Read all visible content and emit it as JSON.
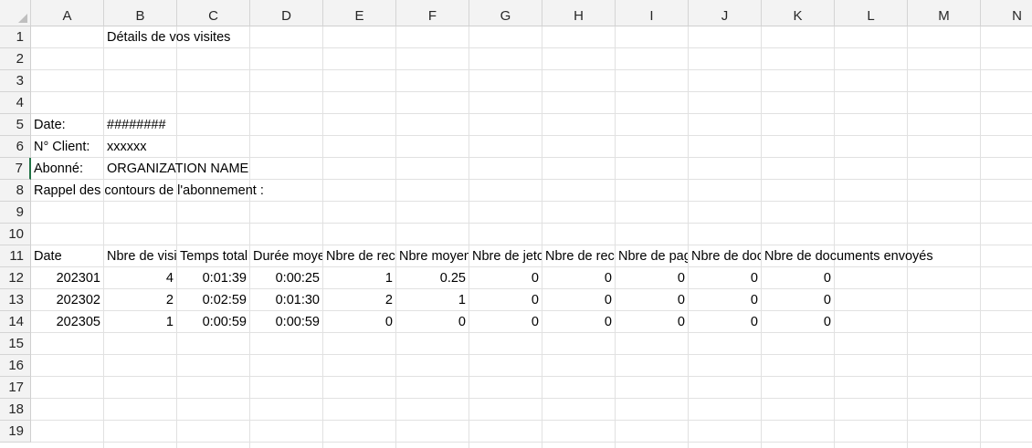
{
  "columns": [
    "A",
    "B",
    "C",
    "D",
    "E",
    "F",
    "G",
    "H",
    "I",
    "J",
    "K",
    "L",
    "M",
    "N"
  ],
  "rows": [
    "1",
    "2",
    "3",
    "4",
    "5",
    "6",
    "7",
    "8",
    "9",
    "10",
    "11",
    "12",
    "13",
    "14",
    "15",
    "16",
    "17",
    "18",
    "19"
  ],
  "selected_row": "7",
  "cells": {
    "b1": "Détails de vos visites",
    "a5": "Date:",
    "b5": "########",
    "a6": "N° Client:",
    "b6": "xxxxxx",
    "a7": "Abonné:",
    "b7": "ORGANIZATION NAME",
    "a8": "Rappel des contours de l'abonnement :"
  },
  "table": {
    "headers": [
      "Date",
      "Nbre de visites",
      "Temps total",
      "Durée moyenne",
      "Nbre de recherches",
      "Nbre moyen",
      "Nbre de jetons",
      "Nbre de recherches",
      "Nbre de pages",
      "Nbre de documents",
      "Nbre de documents envoyés"
    ],
    "rows": [
      [
        "202301",
        "4",
        "0:01:39",
        "0:00:25",
        "1",
        "0.25",
        "0",
        "0",
        "0",
        "0",
        "0"
      ],
      [
        "202302",
        "2",
        "0:02:59",
        "0:01:30",
        "2",
        "1",
        "0",
        "0",
        "0",
        "0",
        "0"
      ],
      [
        "202305",
        "1",
        "0:00:59",
        "0:00:59",
        "0",
        "0",
        "0",
        "0",
        "0",
        "0",
        "0"
      ]
    ]
  }
}
